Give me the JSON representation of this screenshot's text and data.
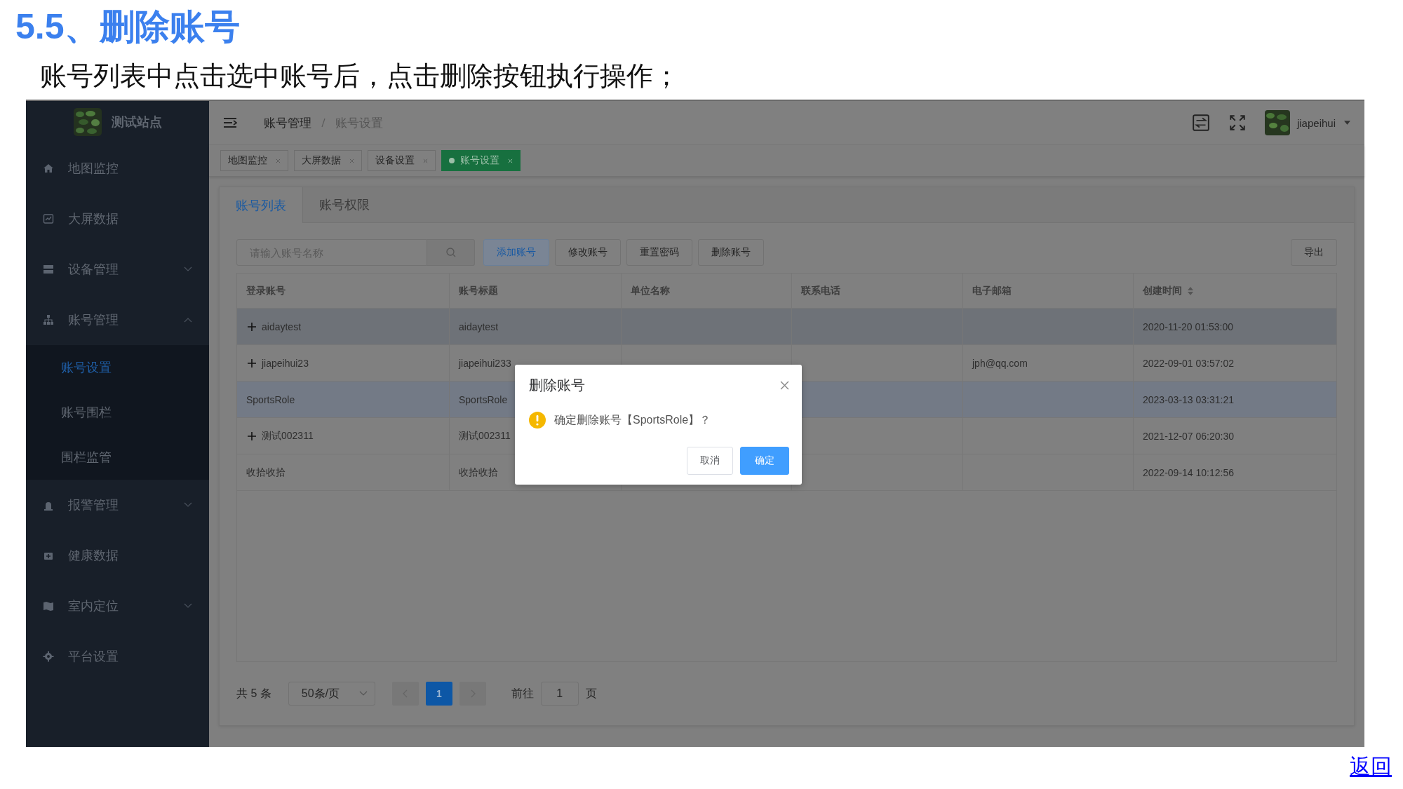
{
  "heading": "5.5、删除账号",
  "description": "账号列表中点击选中账号后，点击删除按钮执行操作；",
  "app": {
    "site_name": "测试站点",
    "sidebar": [
      {
        "label": "地图监控",
        "selected": false
      },
      {
        "label": "大屏数据",
        "selected": false
      },
      {
        "label": "设备管理",
        "selected": false,
        "expanded": false
      },
      {
        "label": "账号管理",
        "selected": false,
        "expanded": true,
        "children": [
          {
            "label": "账号设置",
            "selected": true
          },
          {
            "label": "账号围栏",
            "selected": false
          },
          {
            "label": "围栏监管",
            "selected": false
          }
        ]
      },
      {
        "label": "报警管理",
        "selected": false,
        "expanded": false
      },
      {
        "label": "健康数据",
        "selected": false
      },
      {
        "label": "室内定位",
        "selected": false,
        "expanded": false
      },
      {
        "label": "平台设置",
        "selected": false
      }
    ],
    "breadcrumb": [
      "账号管理",
      "账号设置"
    ],
    "user": "jiapeihui",
    "tags": [
      {
        "label": "地图监控",
        "selected": false
      },
      {
        "label": "大屏数据",
        "selected": false
      },
      {
        "label": "设备设置",
        "selected": false
      },
      {
        "label": "账号设置",
        "selected": true
      }
    ],
    "tabs": [
      {
        "label": "账号列表",
        "selected": true
      },
      {
        "label": "账号权限",
        "selected": false
      }
    ],
    "search": {
      "placeholder": "请输入账号名称"
    },
    "buttons": [
      {
        "label": "添加账号",
        "kind": "primary"
      },
      {
        "label": "修改账号",
        "kind": "default"
      },
      {
        "label": "重置密码",
        "kind": "default"
      },
      {
        "label": "删除账号",
        "kind": "default"
      }
    ],
    "export_button": "导出",
    "table": {
      "columns": [
        {
          "label": "登录账号",
          "sortable": false
        },
        {
          "label": "账号标题",
          "sortable": false
        },
        {
          "label": "单位名称",
          "sortable": false
        },
        {
          "label": "联系电话",
          "sortable": false
        },
        {
          "label": "电子邮箱",
          "sortable": false
        },
        {
          "label": "创建时间",
          "sortable": true
        }
      ],
      "rows": [
        {
          "expandable": true,
          "hovered": true,
          "selected": false,
          "cells": [
            "aidaytest",
            "aidaytest",
            "",
            "",
            "",
            "2020-11-20 01:53:00"
          ]
        },
        {
          "expandable": true,
          "hovered": false,
          "selected": false,
          "cells": [
            "jiapeihui23",
            "jiapeihui233",
            "",
            "",
            "jph@qq.com",
            "2022-09-01 03:57:02"
          ]
        },
        {
          "expandable": false,
          "hovered": false,
          "selected": true,
          "cells": [
            "SportsRole",
            "SportsRole",
            "",
            "",
            "",
            "2023-03-13 03:31:21"
          ]
        },
        {
          "expandable": true,
          "hovered": false,
          "selected": false,
          "cells": [
            "测试002311",
            "测试002311",
            "",
            "",
            "",
            "2021-12-07 06:20:30"
          ]
        },
        {
          "expandable": false,
          "hovered": false,
          "selected": false,
          "cells": [
            "收拾收拾",
            "收拾收拾",
            "",
            "",
            "",
            "2022-09-14 10:12:56"
          ]
        }
      ]
    },
    "pagination": {
      "total": "共 5 条",
      "page_size": "50条/页",
      "pages": [
        {
          "label": "1",
          "selected": true
        }
      ],
      "goto_label": "前往",
      "goto_value": "1",
      "goto_unit": "页"
    },
    "dialog": {
      "title": "删除账号",
      "message": "确定删除账号【SportsRole】？",
      "cancel": "取消",
      "confirm": "确定"
    }
  },
  "back_link": "返回"
}
